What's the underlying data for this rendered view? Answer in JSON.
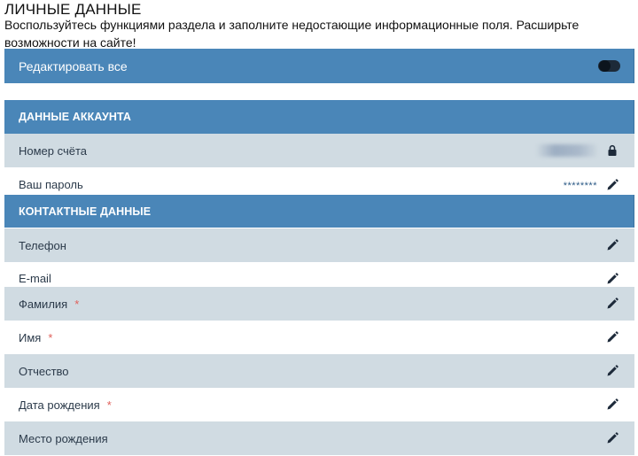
{
  "header": {
    "title": "ЛИЧНЫЕ ДАННЫЕ",
    "intro": "Воспользуйтесь функциями раздела и заполните недостающие информационные поля. Расширьте возможности на сайте!"
  },
  "edit_all": {
    "label": "Редактировать все",
    "toggle_on": false
  },
  "sections": {
    "account": {
      "title": "ДАННЫЕ АККАУНТА",
      "rows": [
        {
          "label": "Номер счёта",
          "icon": "lock-icon"
        },
        {
          "label": "Ваш пароль",
          "value": "********",
          "icon": "pencil-icon"
        }
      ]
    },
    "contacts": {
      "title": "КОНТАКТНЫЕ ДАННЫЕ",
      "rows": [
        {
          "label": "Телефон",
          "required": false,
          "icon": "pencil-icon"
        },
        {
          "label": "E-mail",
          "required": false,
          "icon": "pencil-icon"
        },
        {
          "label": "Фамилия",
          "required": true,
          "required_mark": "*",
          "icon": "pencil-icon"
        },
        {
          "label": "Имя",
          "required": true,
          "required_mark": "*",
          "icon": "pencil-icon"
        },
        {
          "label": "Отчество",
          "required": false,
          "icon": "pencil-icon"
        },
        {
          "label": "Дата рождения",
          "required": true,
          "required_mark": "*",
          "icon": "pencil-icon"
        },
        {
          "label": "Место рождения",
          "required": false,
          "icon": "pencil-icon"
        }
      ]
    }
  },
  "colors": {
    "header_bar": "#4a86b8",
    "row_shade": "#d0dbe2",
    "required_mark": "#e0605a",
    "icon": "#1d2a3a"
  }
}
